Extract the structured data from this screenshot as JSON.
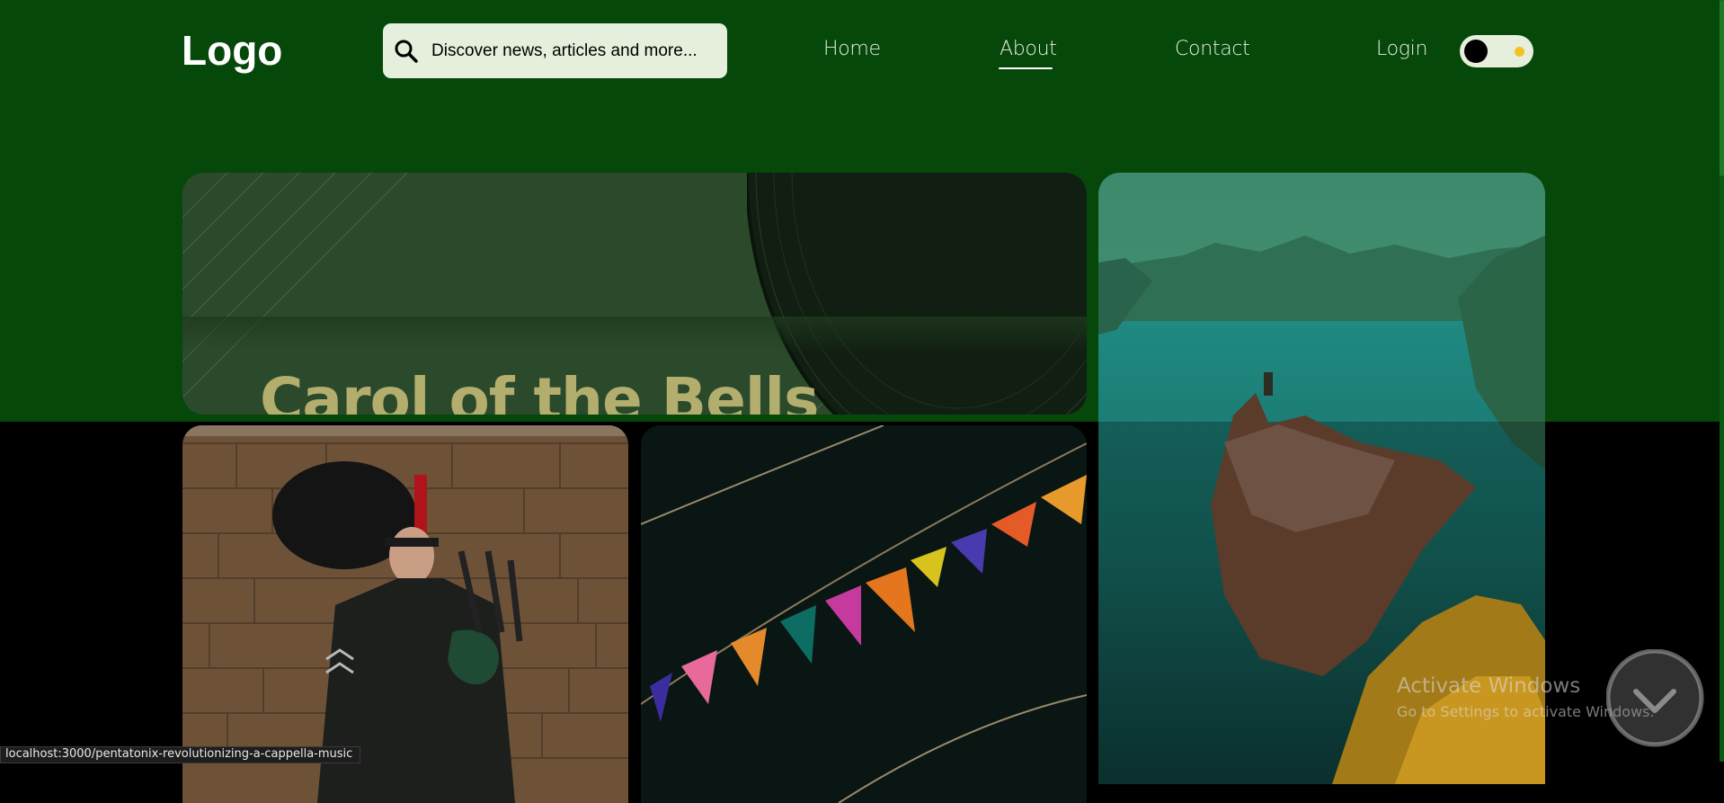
{
  "header": {
    "logo": "Logo",
    "search": {
      "placeholder": "Discover news, articles and more...",
      "icon": "search-icon"
    },
    "nav": [
      {
        "label": "Home"
      },
      {
        "label": "About",
        "active": true
      },
      {
        "label": "Contact"
      },
      {
        "label": "Login"
      }
    ],
    "theme_toggle": {
      "state": "dark"
    }
  },
  "featured": {
    "title": "Carol of the Bells"
  },
  "cards": [
    {
      "image": "coastal-village-landscape"
    },
    {
      "image": "bagpipe-player"
    },
    {
      "image": "colorful-bunting-flags"
    }
  ],
  "watermark": {
    "title": "Activate Windows",
    "subtitle": "Go to Settings to activate Windows."
  },
  "status_bar": {
    "url": "localhost:3000/pentatonix-revolutionizing-a-cappella-music"
  },
  "colors": {
    "header_bg": "#06470a",
    "page_bg": "#000000",
    "search_bg": "#e6efdc",
    "title_color": "#b3ad6e",
    "toggle_dot": "#f4c21f"
  }
}
